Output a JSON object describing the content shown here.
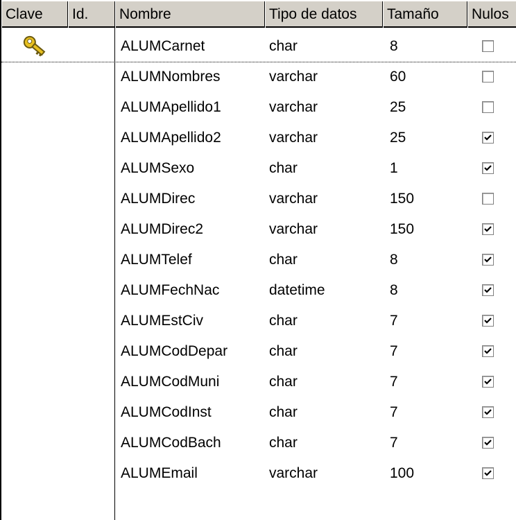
{
  "headers": [
    "Clave",
    "Id.",
    "Nombre",
    "Tipo de datos",
    "Tamaño",
    "Nulos"
  ],
  "rows": [
    {
      "key": true,
      "name": "ALUMCarnet",
      "type": "char",
      "size": "8",
      "nullable": false
    },
    {
      "key": false,
      "name": "ALUMNombres",
      "type": "varchar",
      "size": "60",
      "nullable": false
    },
    {
      "key": false,
      "name": "ALUMApellido1",
      "type": "varchar",
      "size": "25",
      "nullable": false
    },
    {
      "key": false,
      "name": "ALUMApellido2",
      "type": "varchar",
      "size": "25",
      "nullable": true
    },
    {
      "key": false,
      "name": "ALUMSexo",
      "type": "char",
      "size": "1",
      "nullable": true
    },
    {
      "key": false,
      "name": "ALUMDirec",
      "type": "varchar",
      "size": "150",
      "nullable": false
    },
    {
      "key": false,
      "name": "ALUMDirec2",
      "type": "varchar",
      "size": "150",
      "nullable": true
    },
    {
      "key": false,
      "name": "ALUMTelef",
      "type": "char",
      "size": "8",
      "nullable": true
    },
    {
      "key": false,
      "name": "ALUMFechNac",
      "type": "datetime",
      "size": "8",
      "nullable": true
    },
    {
      "key": false,
      "name": "ALUMEstCiv",
      "type": "char",
      "size": "7",
      "nullable": true
    },
    {
      "key": false,
      "name": "ALUMCodDepar",
      "type": "char",
      "size": "7",
      "nullable": true
    },
    {
      "key": false,
      "name": "ALUMCodMuni",
      "type": "char",
      "size": "7",
      "nullable": true
    },
    {
      "key": false,
      "name": "ALUMCodInst",
      "type": "char",
      "size": "7",
      "nullable": true
    },
    {
      "key": false,
      "name": "ALUMCodBach",
      "type": "char",
      "size": "7",
      "nullable": true
    },
    {
      "key": false,
      "name": "ALUMEmail",
      "type": "varchar",
      "size": "100",
      "nullable": true
    }
  ],
  "colors": {
    "header_bg": "#d4d0c8",
    "key_gold": "#e8c020",
    "check": "#000000"
  },
  "icons": {
    "primary_key": "key-icon"
  }
}
